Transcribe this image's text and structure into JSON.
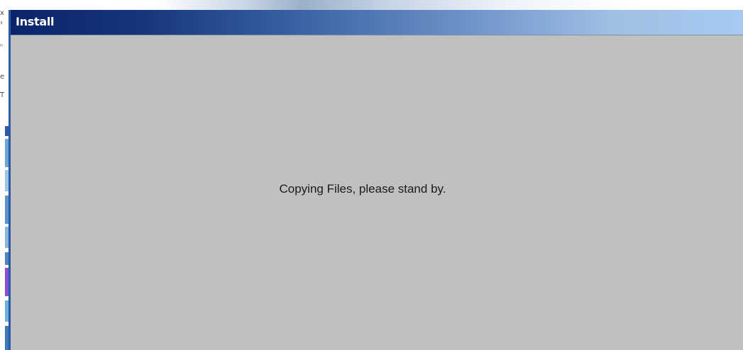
{
  "dialog": {
    "title": "Install",
    "message": "Copying Files, please stand by."
  },
  "colors": {
    "title_bar_start": "#0a246a",
    "title_bar_end": "#a6caf0",
    "dialog_background": "#c0c0c0",
    "title_text": "#ffffff",
    "message_text": "#1a1a1a"
  }
}
